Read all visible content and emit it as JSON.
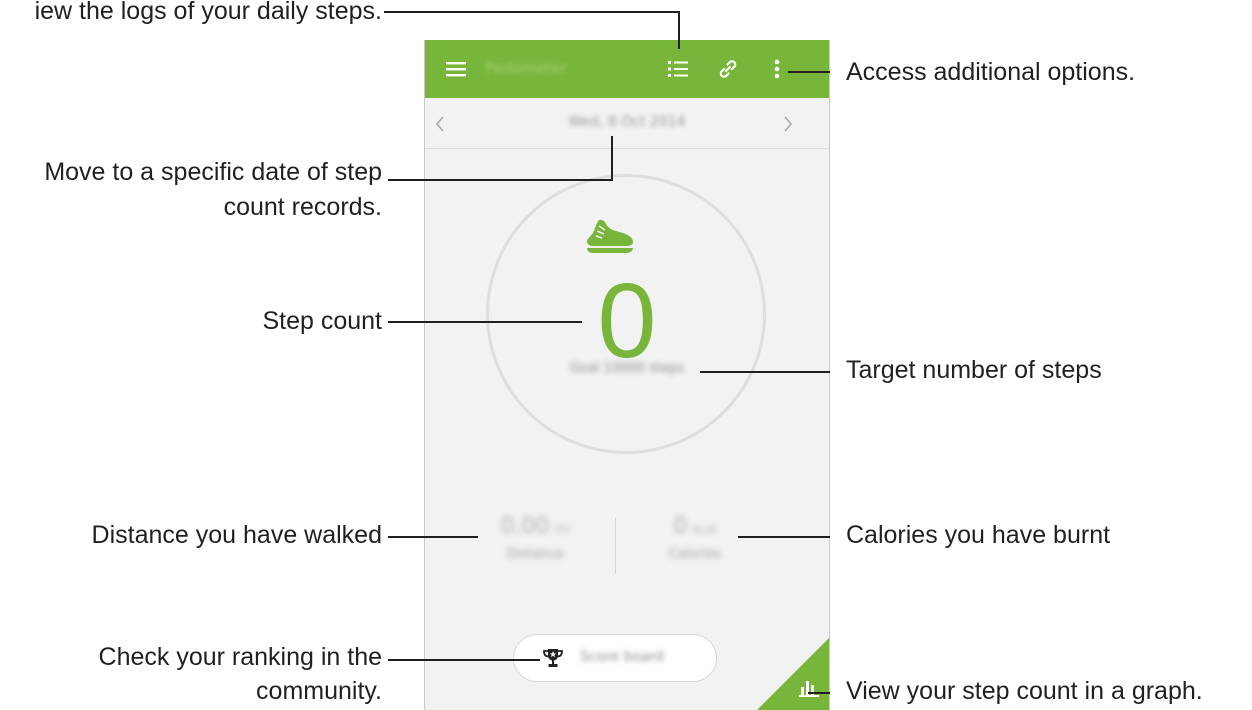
{
  "app": {
    "title": "Pedometer",
    "date": "Wed, 8 Oct 2014",
    "step_count": "0",
    "goal": "Goal 10000 steps",
    "distance": {
      "value": "0.00",
      "unit": "mi",
      "label": "Distance"
    },
    "calories": {
      "value": "0",
      "unit": "kcal",
      "label": "Calories"
    },
    "score_board_label": "Score board",
    "accent_color": "#78b53b"
  },
  "icons": {
    "menu": "hamburger-menu-icon",
    "logs": "list-icon",
    "connect": "link-icon",
    "more": "more-vert-icon",
    "prev": "chevron-left-icon",
    "next": "chevron-right-icon",
    "shoe": "shoe-icon",
    "trophy": "trophy-icon",
    "graph": "bar-chart-icon"
  },
  "callouts": {
    "logs": "iew the logs of your daily steps.",
    "options": "Access additional options.",
    "date_line1": "Move to a specific date of step",
    "date_line2": "count records.",
    "step_count": "Step count",
    "target": "Target number of steps",
    "distance": "Distance you have walked",
    "calories": "Calories you have burnt",
    "ranking_line1": "Check your ranking in the",
    "ranking_line2": "community.",
    "graph": "View your step count in a graph."
  }
}
